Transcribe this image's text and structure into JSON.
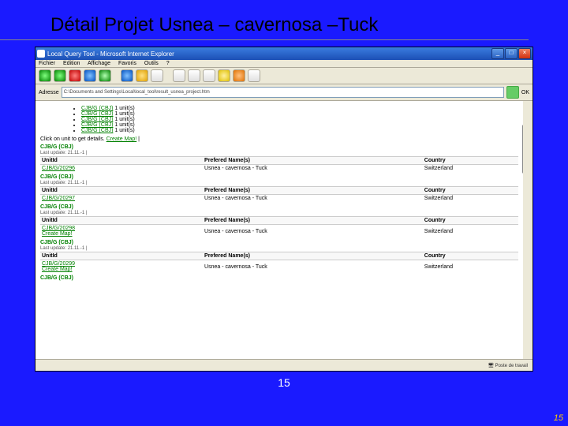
{
  "slide": {
    "title": "Détail Projet Usnea – cavernosa –Tuck"
  },
  "window": {
    "title": "Local Query Tool - Microsoft Internet Explorer",
    "menu": [
      "Fichier",
      "Edition",
      "Affichage",
      "Favoris",
      "Outils",
      "?"
    ],
    "address_label": "Adresse",
    "address": "C:\\Documents and Settings\\Local\\local_tool\\result_usnea_project.htm",
    "go": "OK",
    "statusbar": "Poste de travail"
  },
  "page": {
    "units_label": " 1 unit(s)",
    "unit_lines": [
      "CJB/G (CBJ)",
      "CJB/G (CBJ)",
      "CJB/G (CBJ)",
      "CJB/G (CBJ)",
      "CJB/G (CBJ)"
    ],
    "click_hint": "Click on unit to get details. ",
    "create_map": "Create Map!",
    "last_update_label": "Last update: ",
    "last_update_value": "21.11.-1 |",
    "headers": {
      "unit": "UnitId",
      "name": "Prefered Name(s)",
      "country": "Country"
    },
    "prefname": "Usnea - cavernosa - Tuck",
    "country": "Switzerland",
    "section_label": "CJB/G (CBJ)",
    "records": [
      {
        "unitid": "CJB/G/20296",
        "show_create_map": false
      },
      {
        "unitid": "CJB/G/20297",
        "show_create_map": false
      },
      {
        "unitid": "CJB/G/20298",
        "show_create_map": true
      },
      {
        "unitid": "CJB/G/20299",
        "show_create_map": true
      }
    ]
  },
  "footer": {
    "center": "15",
    "corner": "15"
  }
}
